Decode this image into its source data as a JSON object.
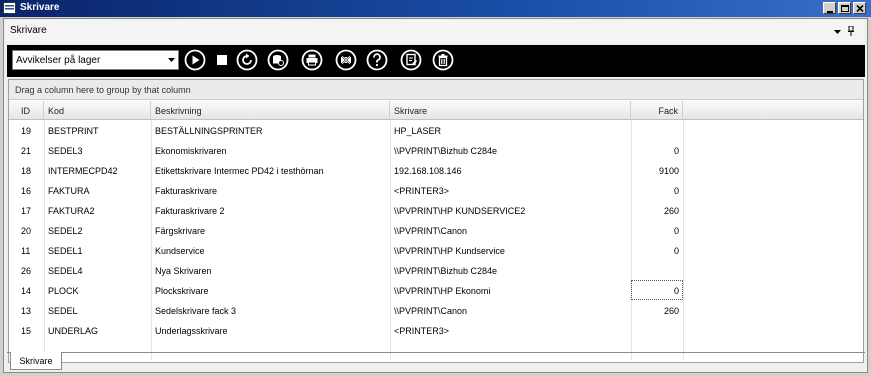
{
  "window": {
    "title": "Skrivare"
  },
  "panel": {
    "title": "Skrivare"
  },
  "toolbar": {
    "filter_selected": "Avvikelser på lager",
    "buttons": [
      {
        "name": "play-icon"
      },
      {
        "name": "stop-icon"
      },
      {
        "name": "refresh-icon"
      },
      {
        "name": "database-settings-icon"
      },
      {
        "name": "print-icon"
      },
      {
        "name": "cancel-print-icon"
      },
      {
        "name": "help-icon"
      },
      {
        "name": "edit-document-icon"
      },
      {
        "name": "trash-icon"
      }
    ]
  },
  "grid": {
    "group_hint": "Drag a column here to group by that column",
    "columns": [
      "ID",
      "Kod",
      "Beskrivning",
      "Skrivare",
      "Fack"
    ],
    "rows": [
      {
        "id": "19",
        "kod": "BESTPRINT",
        "beskrivning": "BESTÄLLNINGSPRINTER",
        "skrivare": "HP_LASER",
        "fack": ""
      },
      {
        "id": "21",
        "kod": "SEDEL3",
        "beskrivning": "Ekonomiskrivaren",
        "skrivare": "\\\\PVPRINT\\Bizhub C284e",
        "fack": "0"
      },
      {
        "id": "18",
        "kod": "INTERMECPD42",
        "beskrivning": "Etikettskrivare Intermec PD42 i testhörnan",
        "skrivare": "192.168.108.146",
        "fack": "9100"
      },
      {
        "id": "16",
        "kod": "FAKTURA",
        "beskrivning": "Fakturaskrivare",
        "skrivare": "<PRINTER3>",
        "fack": "0"
      },
      {
        "id": "17",
        "kod": "FAKTURA2",
        "beskrivning": "Fakturaskrivare 2",
        "skrivare": "\\\\PVPRINT\\HP KUNDSERVICE2",
        "fack": "260"
      },
      {
        "id": "20",
        "kod": "SEDEL2",
        "beskrivning": "Färgskrivare",
        "skrivare": "\\\\PVPRINT\\Canon",
        "fack": "0"
      },
      {
        "id": "11",
        "kod": "SEDEL1",
        "beskrivning": "Kundservice",
        "skrivare": "\\\\PVPRINT\\HP Kundservice",
        "fack": "0"
      },
      {
        "id": "26",
        "kod": "SEDEL4",
        "beskrivning": "Nya Skrivaren",
        "skrivare": "\\\\PVPRINT\\Bizhub C284e",
        "fack": ""
      },
      {
        "id": "14",
        "kod": "PLOCK",
        "beskrivning": "Plockskrivare",
        "skrivare": "\\\\PVPRINT\\HP Ekonomi",
        "fack": "0"
      },
      {
        "id": "13",
        "kod": "SEDEL",
        "beskrivning": "Sedelskrivare fack 3",
        "skrivare": "\\\\PVPRINT\\Canon",
        "fack": "260"
      },
      {
        "id": "15",
        "kod": "UNDERLAG",
        "beskrivning": "Underlagsskrivare",
        "skrivare": "<PRINTER3>",
        "fack": ""
      }
    ]
  },
  "tabs": [
    {
      "label": "Skrivare",
      "active": true
    }
  ]
}
